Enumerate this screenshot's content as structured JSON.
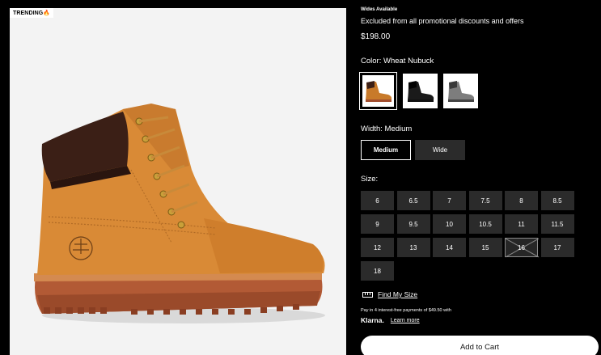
{
  "image": {
    "badge": "TRENDING🔥",
    "product_image_alt": "wheat nubuck boot"
  },
  "details": {
    "wides_notice": "Wides Available",
    "exclusion_note": "Excluded from all promotional discounts and offers",
    "price": "$198.00",
    "color_label": "Color: Wheat Nubuck",
    "swatches": [
      {
        "name": "Wheat Nubuck",
        "color": "#c87a2a",
        "selected": true
      },
      {
        "name": "Black",
        "color": "#1a1a1a",
        "selected": false
      },
      {
        "name": "Grey",
        "color": "#7d7d7d",
        "selected": false
      }
    ],
    "width_label": "Width: Medium",
    "widths": [
      {
        "label": "Medium",
        "selected": true
      },
      {
        "label": "Wide",
        "selected": false
      }
    ],
    "size_label": "Size:",
    "sizes": [
      {
        "label": "6",
        "available": true
      },
      {
        "label": "6.5",
        "available": true
      },
      {
        "label": "7",
        "available": true
      },
      {
        "label": "7.5",
        "available": true
      },
      {
        "label": "8",
        "available": true
      },
      {
        "label": "8.5",
        "available": true
      },
      {
        "label": "9",
        "available": true
      },
      {
        "label": "9.5",
        "available": true
      },
      {
        "label": "10",
        "available": true
      },
      {
        "label": "10.5",
        "available": true
      },
      {
        "label": "11",
        "available": true
      },
      {
        "label": "11.5",
        "available": true
      },
      {
        "label": "12",
        "available": true
      },
      {
        "label": "13",
        "available": true
      },
      {
        "label": "14",
        "available": true
      },
      {
        "label": "15",
        "available": true
      },
      {
        "label": "16",
        "available": false
      },
      {
        "label": "17",
        "available": true
      },
      {
        "label": "18",
        "available": true
      }
    ],
    "find_my_size": "Find My Size",
    "klarna_text": "Pay in 4 interest-free payments of $49.50 with",
    "klarna_logo": "Klarna.",
    "learn_more": "Learn more",
    "add_to_cart": "Add to Cart"
  }
}
